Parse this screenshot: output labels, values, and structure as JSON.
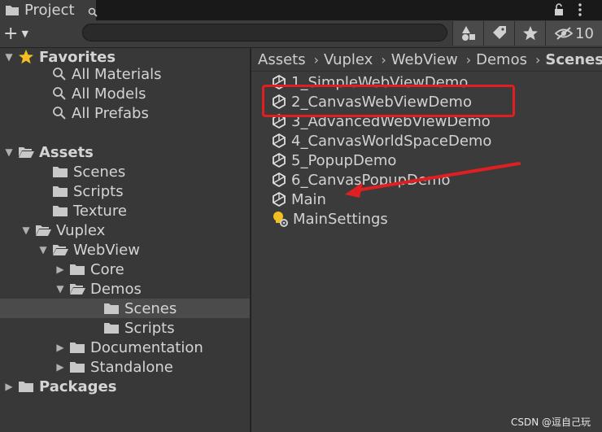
{
  "tab": {
    "label": "Project"
  },
  "toolbar": {
    "search_placeholder": "",
    "hidden_count": "10"
  },
  "tree": [
    {
      "label": "Favorites",
      "level": 0,
      "arrow": "down",
      "icon": "star-icon",
      "section": true
    },
    {
      "label": "All Materials",
      "level": 2,
      "icon": "search-icon"
    },
    {
      "label": "All Models",
      "level": 2,
      "icon": "search-icon"
    },
    {
      "label": "All Prefabs",
      "level": 2,
      "icon": "search-icon"
    },
    {
      "label": "Assets",
      "level": 0,
      "arrow": "down",
      "icon": "folder-open-icon",
      "section": true
    },
    {
      "label": "Scenes",
      "level": 2,
      "icon": "folder-icon"
    },
    {
      "label": "Scripts",
      "level": 2,
      "icon": "folder-icon"
    },
    {
      "label": "Texture",
      "level": 2,
      "icon": "folder-icon"
    },
    {
      "label": "Vuplex",
      "level": 1,
      "arrow": "down",
      "icon": "folder-open-icon"
    },
    {
      "label": "WebView",
      "level": 2,
      "arrow": "down",
      "icon": "folder-open-icon"
    },
    {
      "label": "Core",
      "level": 3,
      "arrow": "right",
      "icon": "folder-icon"
    },
    {
      "label": "Demos",
      "level": 3,
      "arrow": "down",
      "icon": "folder-open-icon"
    },
    {
      "label": "Scenes",
      "level": 5,
      "icon": "folder-icon",
      "selected": true
    },
    {
      "label": "Scripts",
      "level": 5,
      "icon": "folder-icon"
    },
    {
      "label": "Documentation",
      "level": 3,
      "arrow": "right",
      "icon": "folder-icon"
    },
    {
      "label": "Standalone",
      "level": 3,
      "arrow": "right",
      "icon": "folder-icon"
    },
    {
      "label": "Packages",
      "level": 0,
      "arrow": "right",
      "icon": "folder-icon",
      "section": true
    }
  ],
  "breadcrumb": [
    "Assets",
    "Vuplex",
    "WebView",
    "Demos",
    "Scenes"
  ],
  "files": [
    {
      "label": "1_SimpleWebViewDemo",
      "icon": "unity-scene-icon"
    },
    {
      "label": "2_CanvasWebViewDemo",
      "icon": "unity-scene-icon"
    },
    {
      "label": "3_AdvancedWebViewDemo",
      "icon": "unity-scene-icon"
    },
    {
      "label": "4_CanvasWorldSpaceDemo",
      "icon": "unity-scene-icon"
    },
    {
      "label": "5_PopupDemo",
      "icon": "unity-scene-icon"
    },
    {
      "label": "6_CanvasPopupDemo",
      "icon": "unity-scene-icon"
    },
    {
      "label": "Main",
      "icon": "unity-scene-icon"
    },
    {
      "label": "MainSettings",
      "icon": "lighting-settings-icon"
    }
  ],
  "annotation": {
    "color": "#e02020"
  },
  "watermark": "CSDN @逗自己玩"
}
